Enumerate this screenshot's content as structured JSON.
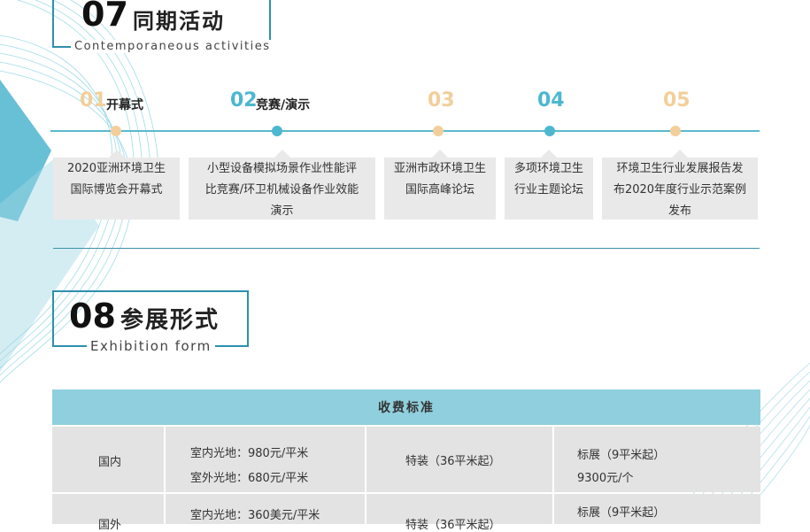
{
  "section7": {
    "number": "07",
    "title": "同期活动",
    "subtitle": "Contemporaneous activities"
  },
  "timeline": [
    {
      "num": "01",
      "label": "开幕式",
      "text": [
        "2020亚洲环境卫生",
        "国际博览会开幕式"
      ],
      "num_color": "#f2cf9a",
      "dot_color": "#f2cf9a"
    },
    {
      "num": "02",
      "label": "竞赛/演示",
      "text": [
        "小型设备模拟场景作业性能评",
        "比竞赛/环卫机械设备作业效能",
        "演示"
      ],
      "num_color": "#4db7d0",
      "dot_color": "#4db7d0"
    },
    {
      "num": "03",
      "label": "",
      "text": [
        "亚洲市政环境卫生",
        "国际高峰论坛"
      ],
      "num_color": "#f2cf9a",
      "dot_color": "#f2cf9a"
    },
    {
      "num": "04",
      "label": "",
      "text": [
        "多项环境卫生",
        "行业主题论坛"
      ],
      "num_color": "#4db7d0",
      "dot_color": "#4db7d0"
    },
    {
      "num": "05",
      "label": "",
      "text": [
        "环境卫生行业发展报告发",
        "布2020年度行业示范案例",
        "发布"
      ],
      "num_color": "#f2cf9a",
      "dot_color": "#f2cf9a"
    }
  ],
  "section8": {
    "number": "08",
    "title": "参展形式",
    "subtitle": "Exhibition form"
  },
  "fee_table": {
    "header": "收费标准",
    "rows": [
      {
        "region": "国内",
        "space": [
          "室内光地：980元/平米",
          "室外光地：680元/平米"
        ],
        "special": "特装（36平米起）",
        "standard": [
          "标展（9平米起）",
          "9300元/个"
        ]
      },
      {
        "region": "国外",
        "space": [
          "室内光地：360美元/平米",
          ""
        ],
        "special": "特装（36平米起）",
        "standard": [
          "标展（9平米起）",
          ""
        ]
      }
    ]
  },
  "colors": {
    "accent_blue": "#4db7d0",
    "accent_gold": "#f2cf9a",
    "table_header": "#90cfdd",
    "frame": "#2e8fae"
  }
}
